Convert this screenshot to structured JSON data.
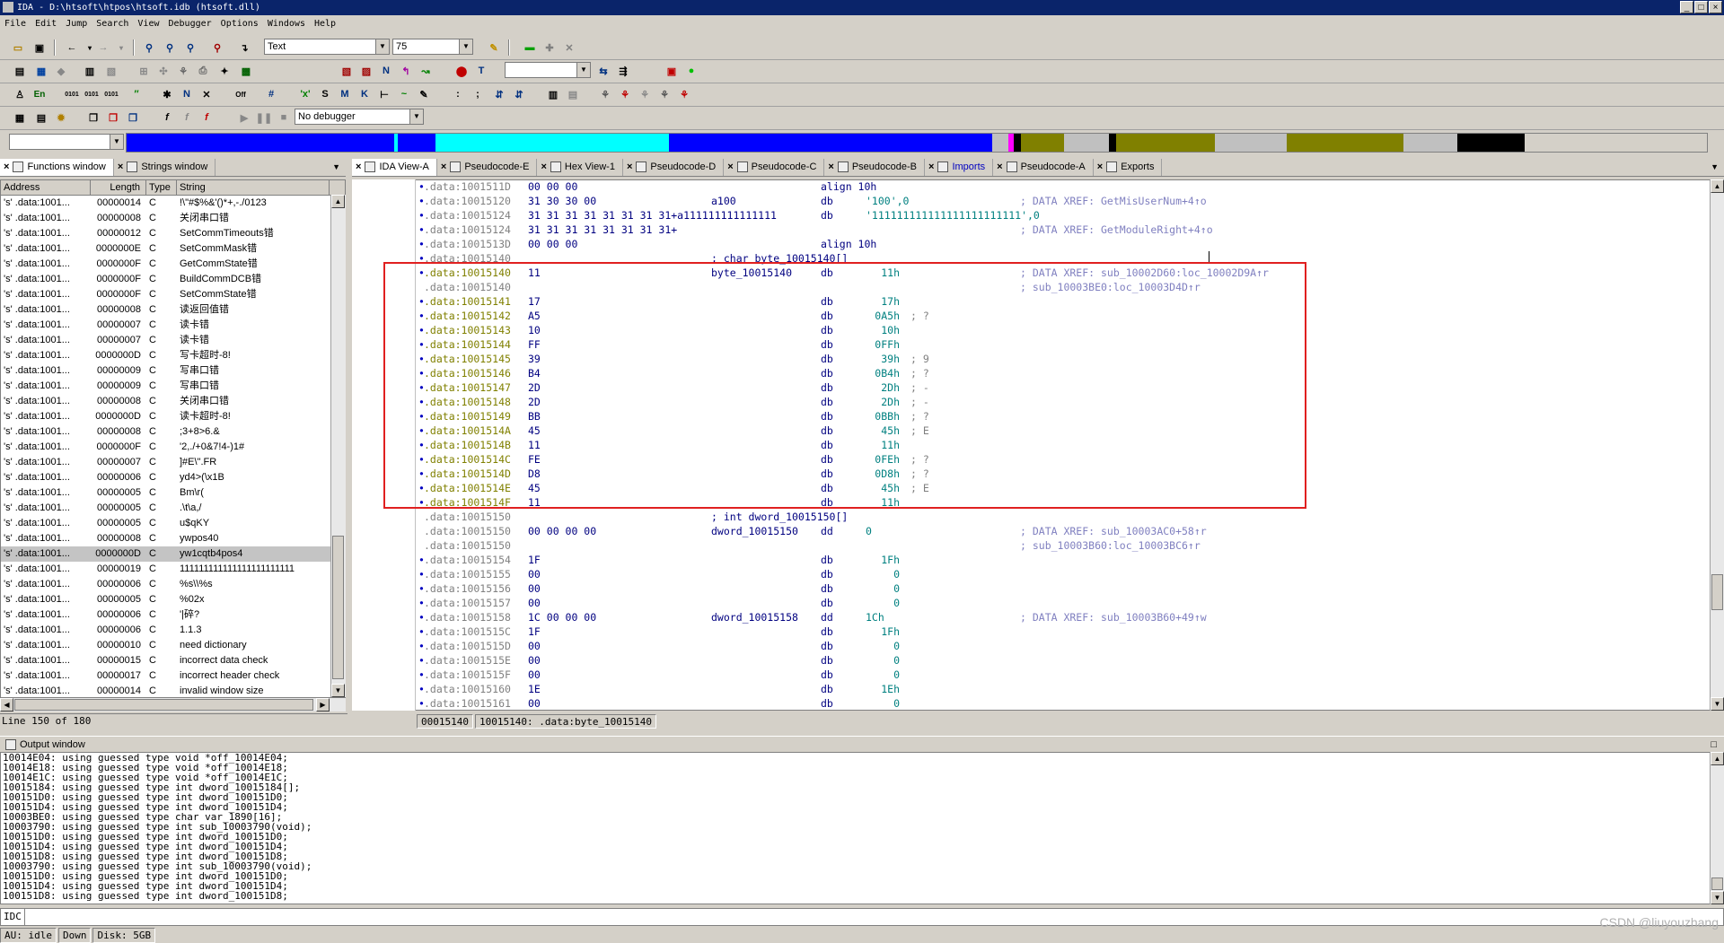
{
  "window": {
    "title": "IDA - D:\\htsoft\\htpos\\htsoft.idb (htsoft.dll)"
  },
  "menu": [
    "File",
    "Edit",
    "Jump",
    "Search",
    "View",
    "Debugger",
    "Options",
    "Windows",
    "Help"
  ],
  "toolbar": {
    "view_combo": "Text",
    "zoom_combo": "75",
    "debugger_combo": "No debugger"
  },
  "nav_colors": {
    "blue": "#0000ff",
    "cyan": "#00ffff",
    "olive": "#808000",
    "gray": "#c0c0c0",
    "black": "#000000",
    "magenta": "#ff00ff"
  },
  "left_tabs": [
    "Functions window",
    "Strings window"
  ],
  "right_tabs": [
    "IDA View-A",
    "Pseudocode-E",
    "Hex View-1",
    "Pseudocode-D",
    "Pseudocode-C",
    "Pseudocode-B",
    "Imports",
    "Pseudocode-A",
    "Exports"
  ],
  "strings": {
    "columns": [
      "Address",
      "Length",
      "Type",
      "String"
    ],
    "rows": [
      [
        "'s' .data:1001...",
        "00000014",
        "C",
        "!\\\"#$%&'()*+,-./0123"
      ],
      [
        "'s' .data:1001...",
        "00000008",
        "C",
        "关闭串口错"
      ],
      [
        "'s' .data:1001...",
        "00000012",
        "C",
        "SetCommTimeouts错"
      ],
      [
        "'s' .data:1001...",
        "0000000E",
        "C",
        "SetCommMask错"
      ],
      [
        "'s' .data:1001...",
        "0000000F",
        "C",
        "GetCommState错"
      ],
      [
        "'s' .data:1001...",
        "0000000F",
        "C",
        "BuildCommDCB错"
      ],
      [
        "'s' .data:1001...",
        "0000000F",
        "C",
        "SetCommState错"
      ],
      [
        "'s' .data:1001...",
        "00000008",
        "C",
        "读返回值错"
      ],
      [
        "'s' .data:1001...",
        "00000007",
        "C",
        "读卡错"
      ],
      [
        "'s' .data:1001...",
        "00000007",
        "C",
        "读卡错"
      ],
      [
        "'s' .data:1001...",
        "0000000D",
        "C",
        "写卡超时-8!"
      ],
      [
        "'s' .data:1001...",
        "00000009",
        "C",
        "写串口错"
      ],
      [
        "'s' .data:1001...",
        "00000009",
        "C",
        "写串口错"
      ],
      [
        "'s' .data:1001...",
        "00000008",
        "C",
        "关闭串口错"
      ],
      [
        "'s' .data:1001...",
        "0000000D",
        "C",
        "读卡超时-8!"
      ],
      [
        "'s' .data:1001...",
        "00000008",
        "C",
        ";3+8>6.&"
      ],
      [
        "'s' .data:1001...",
        "0000000F",
        "C",
        "'2,./+0&7!4-)1#"
      ],
      [
        "'s' .data:1001...",
        "00000007",
        "C",
        "]#E\\\".FR"
      ],
      [
        "'s' .data:1001...",
        "00000006",
        "C",
        "yd4>(\\x1B"
      ],
      [
        "'s' .data:1001...",
        "00000005",
        "C",
        "Bm\\r("
      ],
      [
        "'s' .data:1001...",
        "00000005",
        "C",
        ".\\t\\a,/"
      ],
      [
        "'s' .data:1001...",
        "00000005",
        "C",
        "u$qKY"
      ],
      [
        "'s' .data:1001...",
        "00000008",
        "C",
        "ywpos40"
      ],
      [
        "'s' .data:1001...",
        "0000000D",
        "C",
        "yw1cqtb4pos4"
      ],
      [
        "'s' .data:1001...",
        "00000019",
        "C",
        "111111111111111111111111"
      ],
      [
        "'s' .data:1001...",
        "00000006",
        "C",
        "%s\\\\%s"
      ],
      [
        "'s' .data:1001...",
        "00000005",
        "C",
        "%02x"
      ],
      [
        "'s' .data:1001...",
        "00000006",
        "C",
        "'|碎?"
      ],
      [
        "'s' .data:1001...",
        "00000006",
        "C",
        "1.1.3"
      ],
      [
        "'s' .data:1001...",
        "00000010",
        "C",
        "need dictionary"
      ],
      [
        "'s' .data:1001...",
        "00000015",
        "C",
        "incorrect data check"
      ],
      [
        "'s' .data:1001...",
        "00000017",
        "C",
        "incorrect header check"
      ],
      [
        "'s' .data:1001...",
        "00000014",
        "C",
        "invalid window size"
      ]
    ],
    "selected_index": 23,
    "line_status": "Line 150 of 180"
  },
  "disasm": [
    {
      "d": "•",
      "a": ".data:1001511D",
      "b": "00 00 00",
      "l": "",
      "m": "align 10h",
      "o": "",
      "c": ""
    },
    {
      "d": "•",
      "a": ".data:10015120",
      "b": "31 30 30 00",
      "l": "a100",
      "m": "db",
      "o": "'100',0",
      "c": "; DATA XREF: GetMisUserNum+4↑o"
    },
    {
      "d": "•",
      "a": ".data:10015124",
      "b": "31 31 31 31 31 31 31 31+a111111111111111",
      "l": "",
      "m": "db",
      "o": "'111111111111111111111111',0",
      "c": ""
    },
    {
      "d": "•",
      "a": ".data:10015124",
      "b": "31 31 31 31 31 31 31 31+",
      "l": "",
      "m": "",
      "o": "",
      "c": "; DATA XREF: GetModuleRight+4↑o"
    },
    {
      "d": "•",
      "a": ".data:1001513D",
      "b": "00 00 00",
      "l": "",
      "m": "align 10h",
      "o": "",
      "c": ""
    },
    {
      "d": "•",
      "a": ".data:10015140",
      "b": "",
      "l": "; char byte_10015140[]",
      "m": "",
      "o": "",
      "c": ""
    },
    {
      "d": "•",
      "a": ".data:10015140",
      "b": "11",
      "l": "byte_10015140",
      "m": "db",
      "o": "11h",
      "c": "; DATA XREF: sub_10002D60:loc_10002D9A↑r"
    },
    {
      "d": "",
      "a": ".data:10015140",
      "b": "",
      "l": "",
      "m": "",
      "o": "",
      "c": "; sub_10003BE0:loc_10003D4D↑r"
    },
    {
      "d": "•",
      "a": ".data:10015141",
      "b": "17",
      "l": "",
      "m": "db",
      "o": "17h",
      "c": ""
    },
    {
      "d": "•",
      "a": ".data:10015142",
      "b": "A5",
      "l": "",
      "m": "db",
      "o": "0A5h",
      "c": "; ?"
    },
    {
      "d": "•",
      "a": ".data:10015143",
      "b": "10",
      "l": "",
      "m": "db",
      "o": "10h",
      "c": ""
    },
    {
      "d": "•",
      "a": ".data:10015144",
      "b": "FF",
      "l": "",
      "m": "db",
      "o": "0FFh",
      "c": ""
    },
    {
      "d": "•",
      "a": ".data:10015145",
      "b": "39",
      "l": "",
      "m": "db",
      "o": "39h",
      "c": "; 9"
    },
    {
      "d": "•",
      "a": ".data:10015146",
      "b": "B4",
      "l": "",
      "m": "db",
      "o": "0B4h",
      "c": "; ?"
    },
    {
      "d": "•",
      "a": ".data:10015147",
      "b": "2D",
      "l": "",
      "m": "db",
      "o": "2Dh",
      "c": "; -"
    },
    {
      "d": "•",
      "a": ".data:10015148",
      "b": "2D",
      "l": "",
      "m": "db",
      "o": "2Dh",
      "c": "; -"
    },
    {
      "d": "•",
      "a": ".data:10015149",
      "b": "BB",
      "l": "",
      "m": "db",
      "o": "0BBh",
      "c": "; ?"
    },
    {
      "d": "•",
      "a": ".data:1001514A",
      "b": "45",
      "l": "",
      "m": "db",
      "o": "45h",
      "c": "; E"
    },
    {
      "d": "•",
      "a": ".data:1001514B",
      "b": "11",
      "l": "",
      "m": "db",
      "o": "11h",
      "c": ""
    },
    {
      "d": "•",
      "a": ".data:1001514C",
      "b": "FE",
      "l": "",
      "m": "db",
      "o": "0FEh",
      "c": "; ?"
    },
    {
      "d": "•",
      "a": ".data:1001514D",
      "b": "D8",
      "l": "",
      "m": "db",
      "o": "0D8h",
      "c": "; ?"
    },
    {
      "d": "•",
      "a": ".data:1001514E",
      "b": "45",
      "l": "",
      "m": "db",
      "o": "45h",
      "c": "; E"
    },
    {
      "d": "•",
      "a": ".data:1001514F",
      "b": "11",
      "l": "",
      "m": "db",
      "o": "11h",
      "c": ""
    },
    {
      "d": "",
      "a": ".data:10015150",
      "b": "",
      "l": "; int dword_10015150[]",
      "m": "",
      "o": "",
      "c": ""
    },
    {
      "d": "",
      "a": ".data:10015150",
      "b": "00 00 00 00",
      "l": "dword_10015150",
      "m": "dd",
      "o": "0",
      "c": "; DATA XREF: sub_10003AC0+58↑r"
    },
    {
      "d": "",
      "a": ".data:10015150",
      "b": "",
      "l": "",
      "m": "",
      "o": "",
      "c": "; sub_10003B60:loc_10003BC6↑r"
    },
    {
      "d": "•",
      "a": ".data:10015154",
      "b": "1F",
      "l": "",
      "m": "db",
      "o": "1Fh",
      "c": ""
    },
    {
      "d": "•",
      "a": ".data:10015155",
      "b": "00",
      "l": "",
      "m": "db",
      "o": "0",
      "c": ""
    },
    {
      "d": "•",
      "a": ".data:10015156",
      "b": "00",
      "l": "",
      "m": "db",
      "o": "0",
      "c": ""
    },
    {
      "d": "•",
      "a": ".data:10015157",
      "b": "00",
      "l": "",
      "m": "db",
      "o": "0",
      "c": ""
    },
    {
      "d": "•",
      "a": ".data:10015158",
      "b": "1C 00 00 00",
      "l": "dword_10015158",
      "m": "dd",
      "o": "1Ch",
      "c": "; DATA XREF: sub_10003B60+49↑w"
    },
    {
      "d": "•",
      "a": ".data:1001515C",
      "b": "1F",
      "l": "",
      "m": "db",
      "o": "1Fh",
      "c": ""
    },
    {
      "d": "•",
      "a": ".data:1001515D",
      "b": "00",
      "l": "",
      "m": "db",
      "o": "0",
      "c": ""
    },
    {
      "d": "•",
      "a": ".data:1001515E",
      "b": "00",
      "l": "",
      "m": "db",
      "o": "0",
      "c": ""
    },
    {
      "d": "•",
      "a": ".data:1001515F",
      "b": "00",
      "l": "",
      "m": "db",
      "o": "0",
      "c": ""
    },
    {
      "d": "•",
      "a": ".data:10015160",
      "b": "1E",
      "l": "",
      "m": "db",
      "o": "1Eh",
      "c": ""
    },
    {
      "d": "•",
      "a": ".data:10015161",
      "b": "00",
      "l": "",
      "m": "db",
      "o": "0",
      "c": ""
    }
  ],
  "ida_status": {
    "offset": "00015140",
    "location": "10015140: .data:byte_10015140"
  },
  "output": {
    "title": "Output window",
    "lines": [
      "10014E04: using guessed type void *off_10014E04;",
      "10014E18: using guessed type void *off_10014E18;",
      "10014E1C: using guessed type void *off_10014E1C;",
      "10015184: using guessed type int dword_10015184[];",
      "100151D0: using guessed type int dword_100151D0;",
      "100151D4: using guessed type int dword_100151D4;",
      "10003BE0: using guessed type char var_1890[16];",
      "10003790: using guessed type int sub_10003790(void);",
      "100151D0: using guessed type int dword_100151D0;",
      "100151D4: using guessed type int dword_100151D4;",
      "100151D8: using guessed type int dword_100151D8;",
      "10003790: using guessed type int sub_10003790(void);",
      "100151D0: using guessed type int dword_100151D0;",
      "100151D4: using guessed type int dword_100151D4;",
      "100151D8: using guessed type int dword_100151D8;"
    ]
  },
  "idc_label": "IDC",
  "bottom_status": {
    "au": "AU:  idle",
    "dir": "Down",
    "disk": "Disk: 5GB"
  },
  "watermark": "CSDN @liuyouzhang"
}
